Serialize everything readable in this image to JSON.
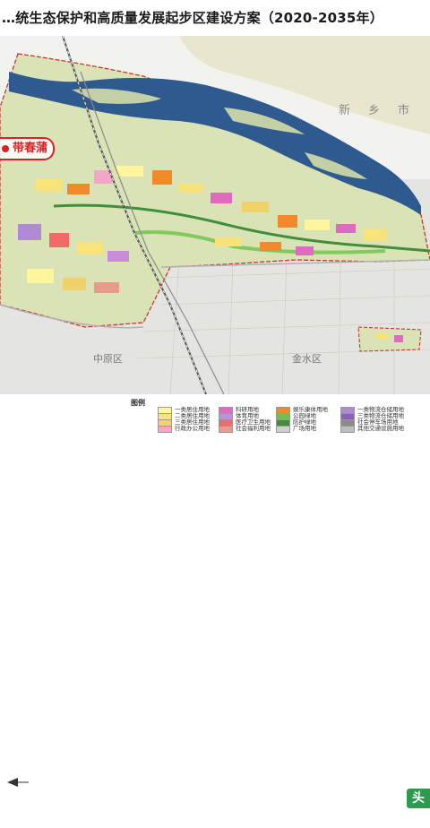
{
  "title": "…统生态保护和高质量发展起步区建设方案（2020-2035年）",
  "map": {
    "city_label": "新乡市",
    "district_left": "中原区",
    "district_right": "金水区",
    "callout": "带春蒲",
    "colors": {
      "river": "#2f5a8f",
      "land": "#dfe7c0",
      "urban": "#e0e0dc",
      "boundary": "#c8362f"
    }
  },
  "legend": {
    "title": "图例",
    "items": [
      {
        "label": "一类居住用地",
        "color": "#fff59d"
      },
      {
        "label": "二类居住用地",
        "color": "#f7e37a"
      },
      {
        "label": "三类居住用地",
        "color": "#f0d26a"
      },
      {
        "label": "行政办公用地",
        "color": "#f4a6c8"
      },
      {
        "label": "科研用地",
        "color": "#e06ac2"
      },
      {
        "label": "体育用地",
        "color": "#c98bd9"
      },
      {
        "label": "医疗卫生用地",
        "color": "#f06a6a"
      },
      {
        "label": "社会福利用地",
        "color": "#e89b8b"
      },
      {
        "label": "娱乐康体用地",
        "color": "#f08a2c"
      },
      {
        "label": "公园绿地",
        "color": "#6cc24a"
      },
      {
        "label": "防护绿地",
        "color": "#3f8f3a"
      },
      {
        "label": "广场用地",
        "color": "#cfcfcf"
      },
      {
        "label": "一类物流仓储用地",
        "color": "#b08ad6"
      },
      {
        "label": "三类物流仓储用地",
        "color": "#8a63b8"
      },
      {
        "label": "社会停车场用地",
        "color": "#8a8a8a"
      },
      {
        "label": "其他交通设施用地",
        "color": "#bdbdbd"
      }
    ]
  },
  "watermark": "头条"
}
